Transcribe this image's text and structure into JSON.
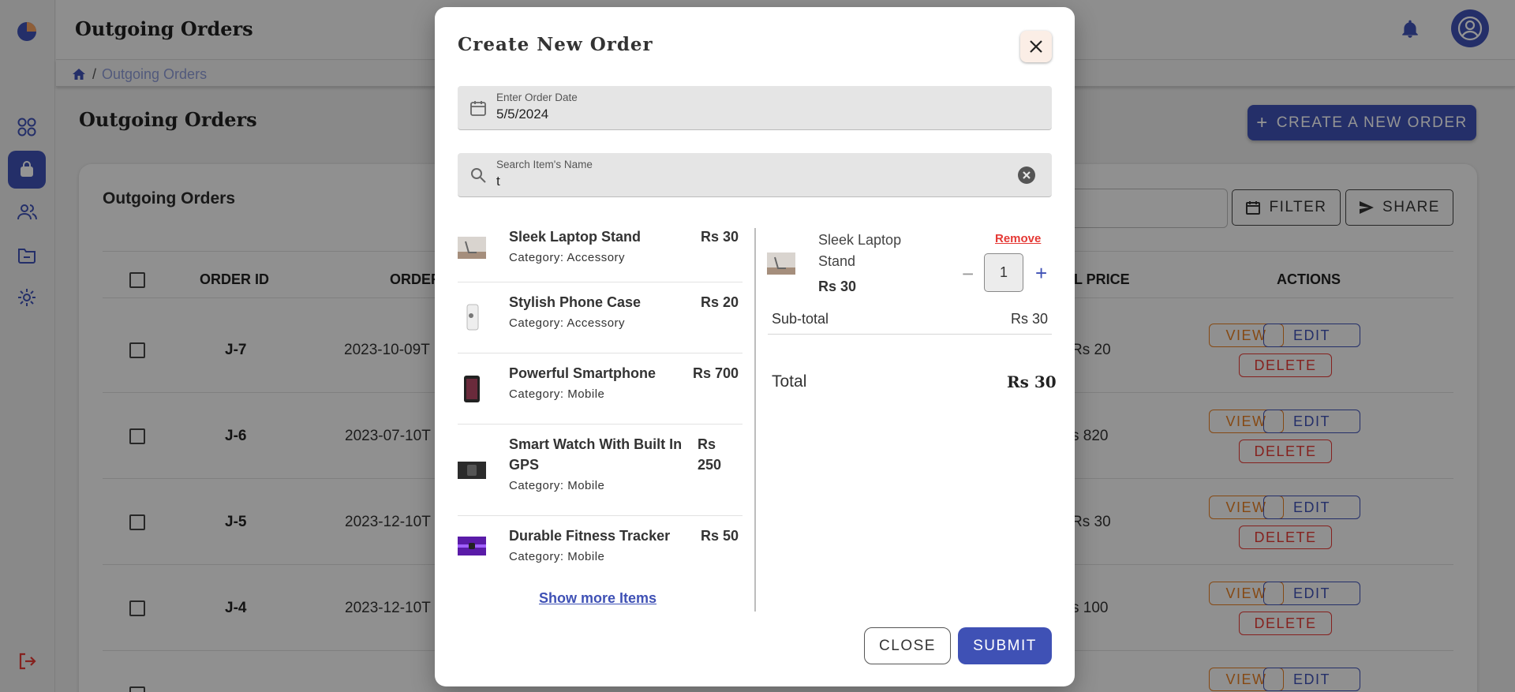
{
  "header": {
    "title": "Outgoing Orders"
  },
  "breadcrumb": {
    "current": "Outgoing Orders",
    "separator": "/"
  },
  "main": {
    "page_title": "Outgoing Orders",
    "create_button": "CREATE A NEW ORDER",
    "card_title": "Outgoing Orders",
    "filter_label": "FILTER",
    "share_label": "SHARE",
    "columns": {
      "order_id": "ORDER ID",
      "order": "ORDER",
      "total_price": "AL PRICE",
      "actions": "ACTIONS"
    },
    "rows": [
      {
        "id": "J-7",
        "date": "2023-10-09T",
        "price": "Rs 20"
      },
      {
        "id": "J-6",
        "date": "2023-07-10T",
        "price": "s 820"
      },
      {
        "id": "J-5",
        "date": "2023-12-10T",
        "price": "Rs 30"
      },
      {
        "id": "J-4",
        "date": "2023-12-10T",
        "price": "s 100"
      }
    ],
    "actions": {
      "view": "VIEW",
      "edit": "EDIT",
      "delete": "DELETE"
    }
  },
  "modal": {
    "title": "Create New Order",
    "date_field": {
      "label": "Enter Order Date",
      "value": "5/5/2024"
    },
    "search_field": {
      "label": "Search Item's Name",
      "value": "t"
    },
    "items": [
      {
        "name_line1": "Sleek Laptop Stand",
        "name_line2": "",
        "category": "Category: Accessory",
        "price_line1": "Rs 30",
        "price_line2": ""
      },
      {
        "name_line1": "Stylish Phone Case",
        "name_line2": "",
        "category": "Category: Accessory",
        "price_line1": "Rs 20",
        "price_line2": ""
      },
      {
        "name_line1": "Powerful Smartphone",
        "name_line2": "",
        "category": "Category: Mobile",
        "price_line1": "Rs 700",
        "price_line2": ""
      },
      {
        "name_line1": "Smart Watch With Built In",
        "name_line2": "GPS",
        "category": "Category: Mobile",
        "price_line1": "Rs",
        "price_line2": "250"
      },
      {
        "name_line1": "Durable Fitness Tracker",
        "name_line2": "",
        "category": "Category: Mobile",
        "price_line1": "Rs 50",
        "price_line2": ""
      }
    ],
    "show_more": "Show more Items",
    "cart": {
      "name_line1": "Sleek Laptop",
      "name_line2": "Stand",
      "price": "Rs 30",
      "remove": "Remove",
      "quantity": "1",
      "minus": "−",
      "plus": "+",
      "subtotal_label": "Sub-total",
      "subtotal_value": "Rs 30",
      "total_label": "Total",
      "total_value": "Rs 30"
    },
    "close_button": "CLOSE",
    "submit_button": "SUBMIT"
  },
  "icons": {
    "logo": "pie-chart-icon",
    "dashboard": "grid-icon",
    "orders": "shopping-bag-icon",
    "users": "users-icon",
    "folder": "folder-icon",
    "settings": "gear-icon",
    "logout": "logout-icon",
    "bell": "bell-icon",
    "account": "account-circle-icon"
  },
  "colors": {
    "primary": "#3f51b5",
    "view": "#e67e22",
    "delete": "#e53935"
  }
}
